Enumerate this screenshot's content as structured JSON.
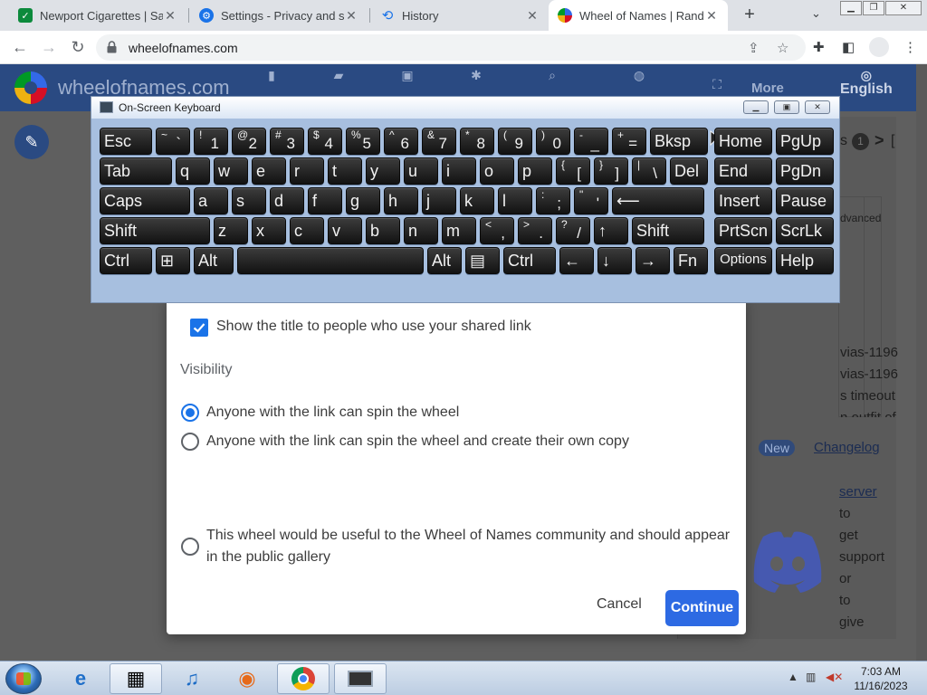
{
  "browser": {
    "tabs": [
      {
        "title": "Newport Cigarettes | Save",
        "icon": "newport-favicon-icon"
      },
      {
        "title": "Settings - Privacy and sec",
        "icon": "settings-gear-icon"
      },
      {
        "title": "History",
        "icon": "history-icon"
      },
      {
        "title": "Wheel of Names | Random",
        "icon": "wheel-of-names-favicon-icon"
      }
    ],
    "address": "wheelofnames.com"
  },
  "site": {
    "title": "wheelofnames.com",
    "nav": [
      "More",
      "English"
    ]
  },
  "sidebar_fragments": {
    "count_badge": "1",
    "advanced": "dvanced",
    "list_lines": [
      "vias-1196",
      "vias-1196",
      "s timeout",
      "n outfit of"
    ],
    "new_badge": "New",
    "changelog": "Changelog",
    "server_link": "server",
    "paragraph": [
      "to",
      "get",
      "support",
      "or",
      "to",
      "give"
    ]
  },
  "dialog": {
    "checkbox_label": "Show the title to people who use your shared link",
    "checkbox_checked": true,
    "visibility_label": "Visibility",
    "options": [
      "Anyone with the link can spin the wheel",
      "Anyone with the link can spin the wheel and create their own copy",
      "This wheel would be useful to the Wheel of Names community and should appear in the public gallery"
    ],
    "selected_option": 0,
    "cancel_label": "Cancel",
    "continue_label": "Continue"
  },
  "osk": {
    "title": "On-Screen Keyboard",
    "rows": [
      [
        {
          "m": "Esc"
        },
        {
          "s": "~",
          "p": "`"
        },
        {
          "s": "!",
          "p": "1"
        },
        {
          "s": "@",
          "p": "2"
        },
        {
          "s": "#",
          "p": "3"
        },
        {
          "s": "$",
          "p": "4"
        },
        {
          "s": "%",
          "p": "5"
        },
        {
          "s": "^",
          "p": "6"
        },
        {
          "s": "&",
          "p": "7"
        },
        {
          "s": "*",
          "p": "8"
        },
        {
          "s": "(",
          "p": "9"
        },
        {
          "s": ")",
          "p": "0"
        },
        {
          "s": "-",
          "p": "_"
        },
        {
          "s": "+",
          "p": "="
        },
        {
          "m": "Bksp"
        },
        {
          "m": "Home"
        },
        {
          "m": "PgUp"
        }
      ],
      [
        {
          "m": "Tab"
        },
        {
          "m": "q"
        },
        {
          "m": "w"
        },
        {
          "m": "e"
        },
        {
          "m": "r"
        },
        {
          "m": "t"
        },
        {
          "m": "y"
        },
        {
          "m": "u"
        },
        {
          "m": "i"
        },
        {
          "m": "o"
        },
        {
          "m": "p"
        },
        {
          "s": "{",
          "p": "["
        },
        {
          "s": "}",
          "p": "]"
        },
        {
          "s": "|",
          "p": "\\"
        },
        {
          "m": "Del"
        },
        {
          "m": "End"
        },
        {
          "m": "PgDn"
        }
      ],
      [
        {
          "m": "Caps"
        },
        {
          "m": "a"
        },
        {
          "m": "s"
        },
        {
          "m": "d"
        },
        {
          "m": "f"
        },
        {
          "m": "g"
        },
        {
          "m": "h"
        },
        {
          "m": "j"
        },
        {
          "m": "k"
        },
        {
          "m": "l"
        },
        {
          "s": ":",
          "p": ";"
        },
        {
          "s": "\"",
          "p": "'"
        },
        {
          "m": "⟵"
        },
        {
          "m": "Insert"
        },
        {
          "m": "Pause"
        }
      ],
      [
        {
          "m": "Shift"
        },
        {
          "m": "z"
        },
        {
          "m": "x"
        },
        {
          "m": "c"
        },
        {
          "m": "v"
        },
        {
          "m": "b"
        },
        {
          "m": "n"
        },
        {
          "m": "m"
        },
        {
          "s": "<",
          "p": ","
        },
        {
          "s": ">",
          "p": "."
        },
        {
          "s": "?",
          "p": "/"
        },
        {
          "m": "↑"
        },
        {
          "m": "Shift"
        },
        {
          "m": "PrtScn"
        },
        {
          "m": "ScrLk"
        }
      ],
      [
        {
          "m": "Ctrl"
        },
        {
          "m": "⊞"
        },
        {
          "m": "Alt"
        },
        {
          "m": ""
        },
        {
          "m": "Alt"
        },
        {
          "m": "▤"
        },
        {
          "m": "Ctrl"
        },
        {
          "m": "←"
        },
        {
          "m": "↓"
        },
        {
          "m": "→"
        },
        {
          "m": "Fn"
        },
        {
          "c": "Options"
        },
        {
          "m": "Help"
        }
      ]
    ]
  },
  "taskbar": {
    "time": "7:03 AM",
    "date": "11/16/2023"
  }
}
